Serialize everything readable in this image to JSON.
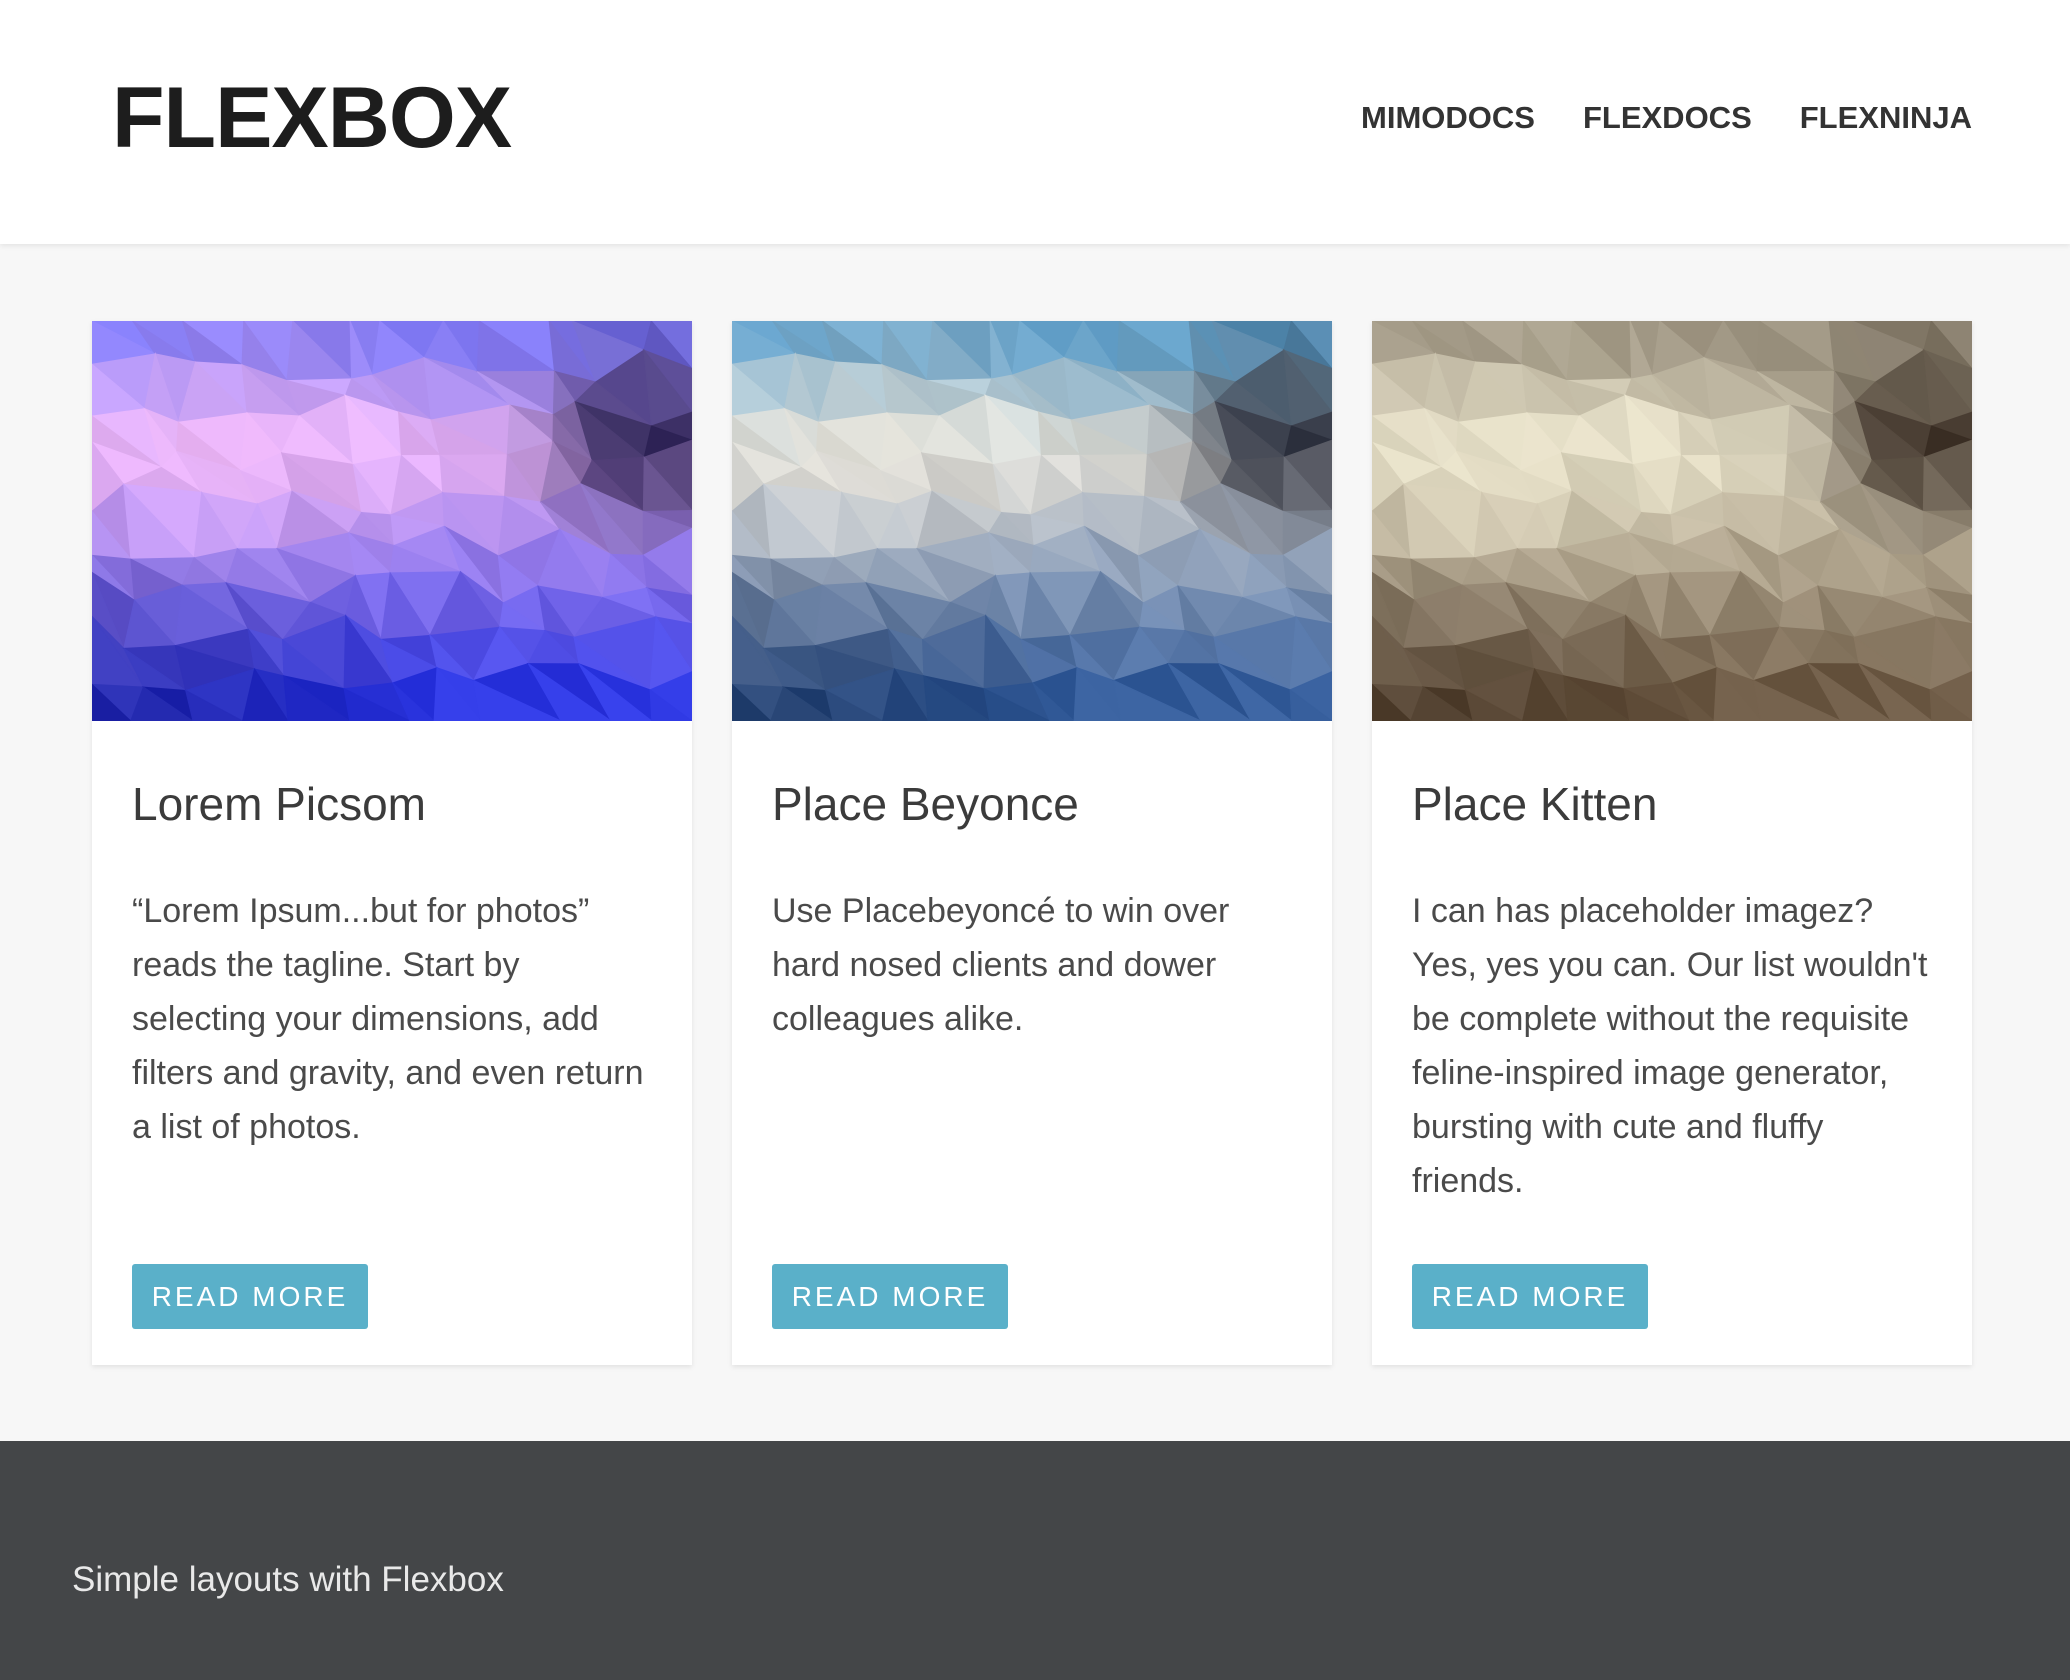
{
  "header": {
    "logo": "FLEXBOX",
    "nav": [
      "MIMODOCS",
      "FLEXDOCS",
      "FLEXNINJA"
    ]
  },
  "cards": [
    {
      "title": "Lorem Picsom",
      "text": "“Lorem Ipsum...but for photos” reads the tagline. Start by selecting your dimensions, add filters and gravity, and even return a list of photos.",
      "button": "READ MORE",
      "palette": {
        "top": "#6b6cf0",
        "highlight": "#f0b8f7",
        "dark": "#141040",
        "bottom": "#2b35e0"
      }
    },
    {
      "title": "Place Beyonce",
      "text": "Use Placebeyoncé to win over hard nosed clients and dower colleagues alike.",
      "button": "READ MORE",
      "palette": {
        "top": "#4a91c2",
        "highlight": "#e6e2d8",
        "dark": "#141828",
        "bottom": "#325a98"
      }
    },
    {
      "title": "Place Kitten",
      "text": "I can has placeholder imagez? Yes, yes you can. Our list wouldn't be complete without the requisite feline-inspired image generator, bursting with cute and fluffy friends.",
      "button": "READ MORE",
      "palette": {
        "top": "#8c8270",
        "highlight": "#e9e3cb",
        "dark": "#23160e",
        "bottom": "#6b5843"
      }
    }
  ],
  "footer": {
    "text": "Simple layouts with Flexbox"
  },
  "colors": {
    "accent": "#5ab0c9",
    "footer_bg": "#444648",
    "page_bg": "#f7f7f7"
  }
}
